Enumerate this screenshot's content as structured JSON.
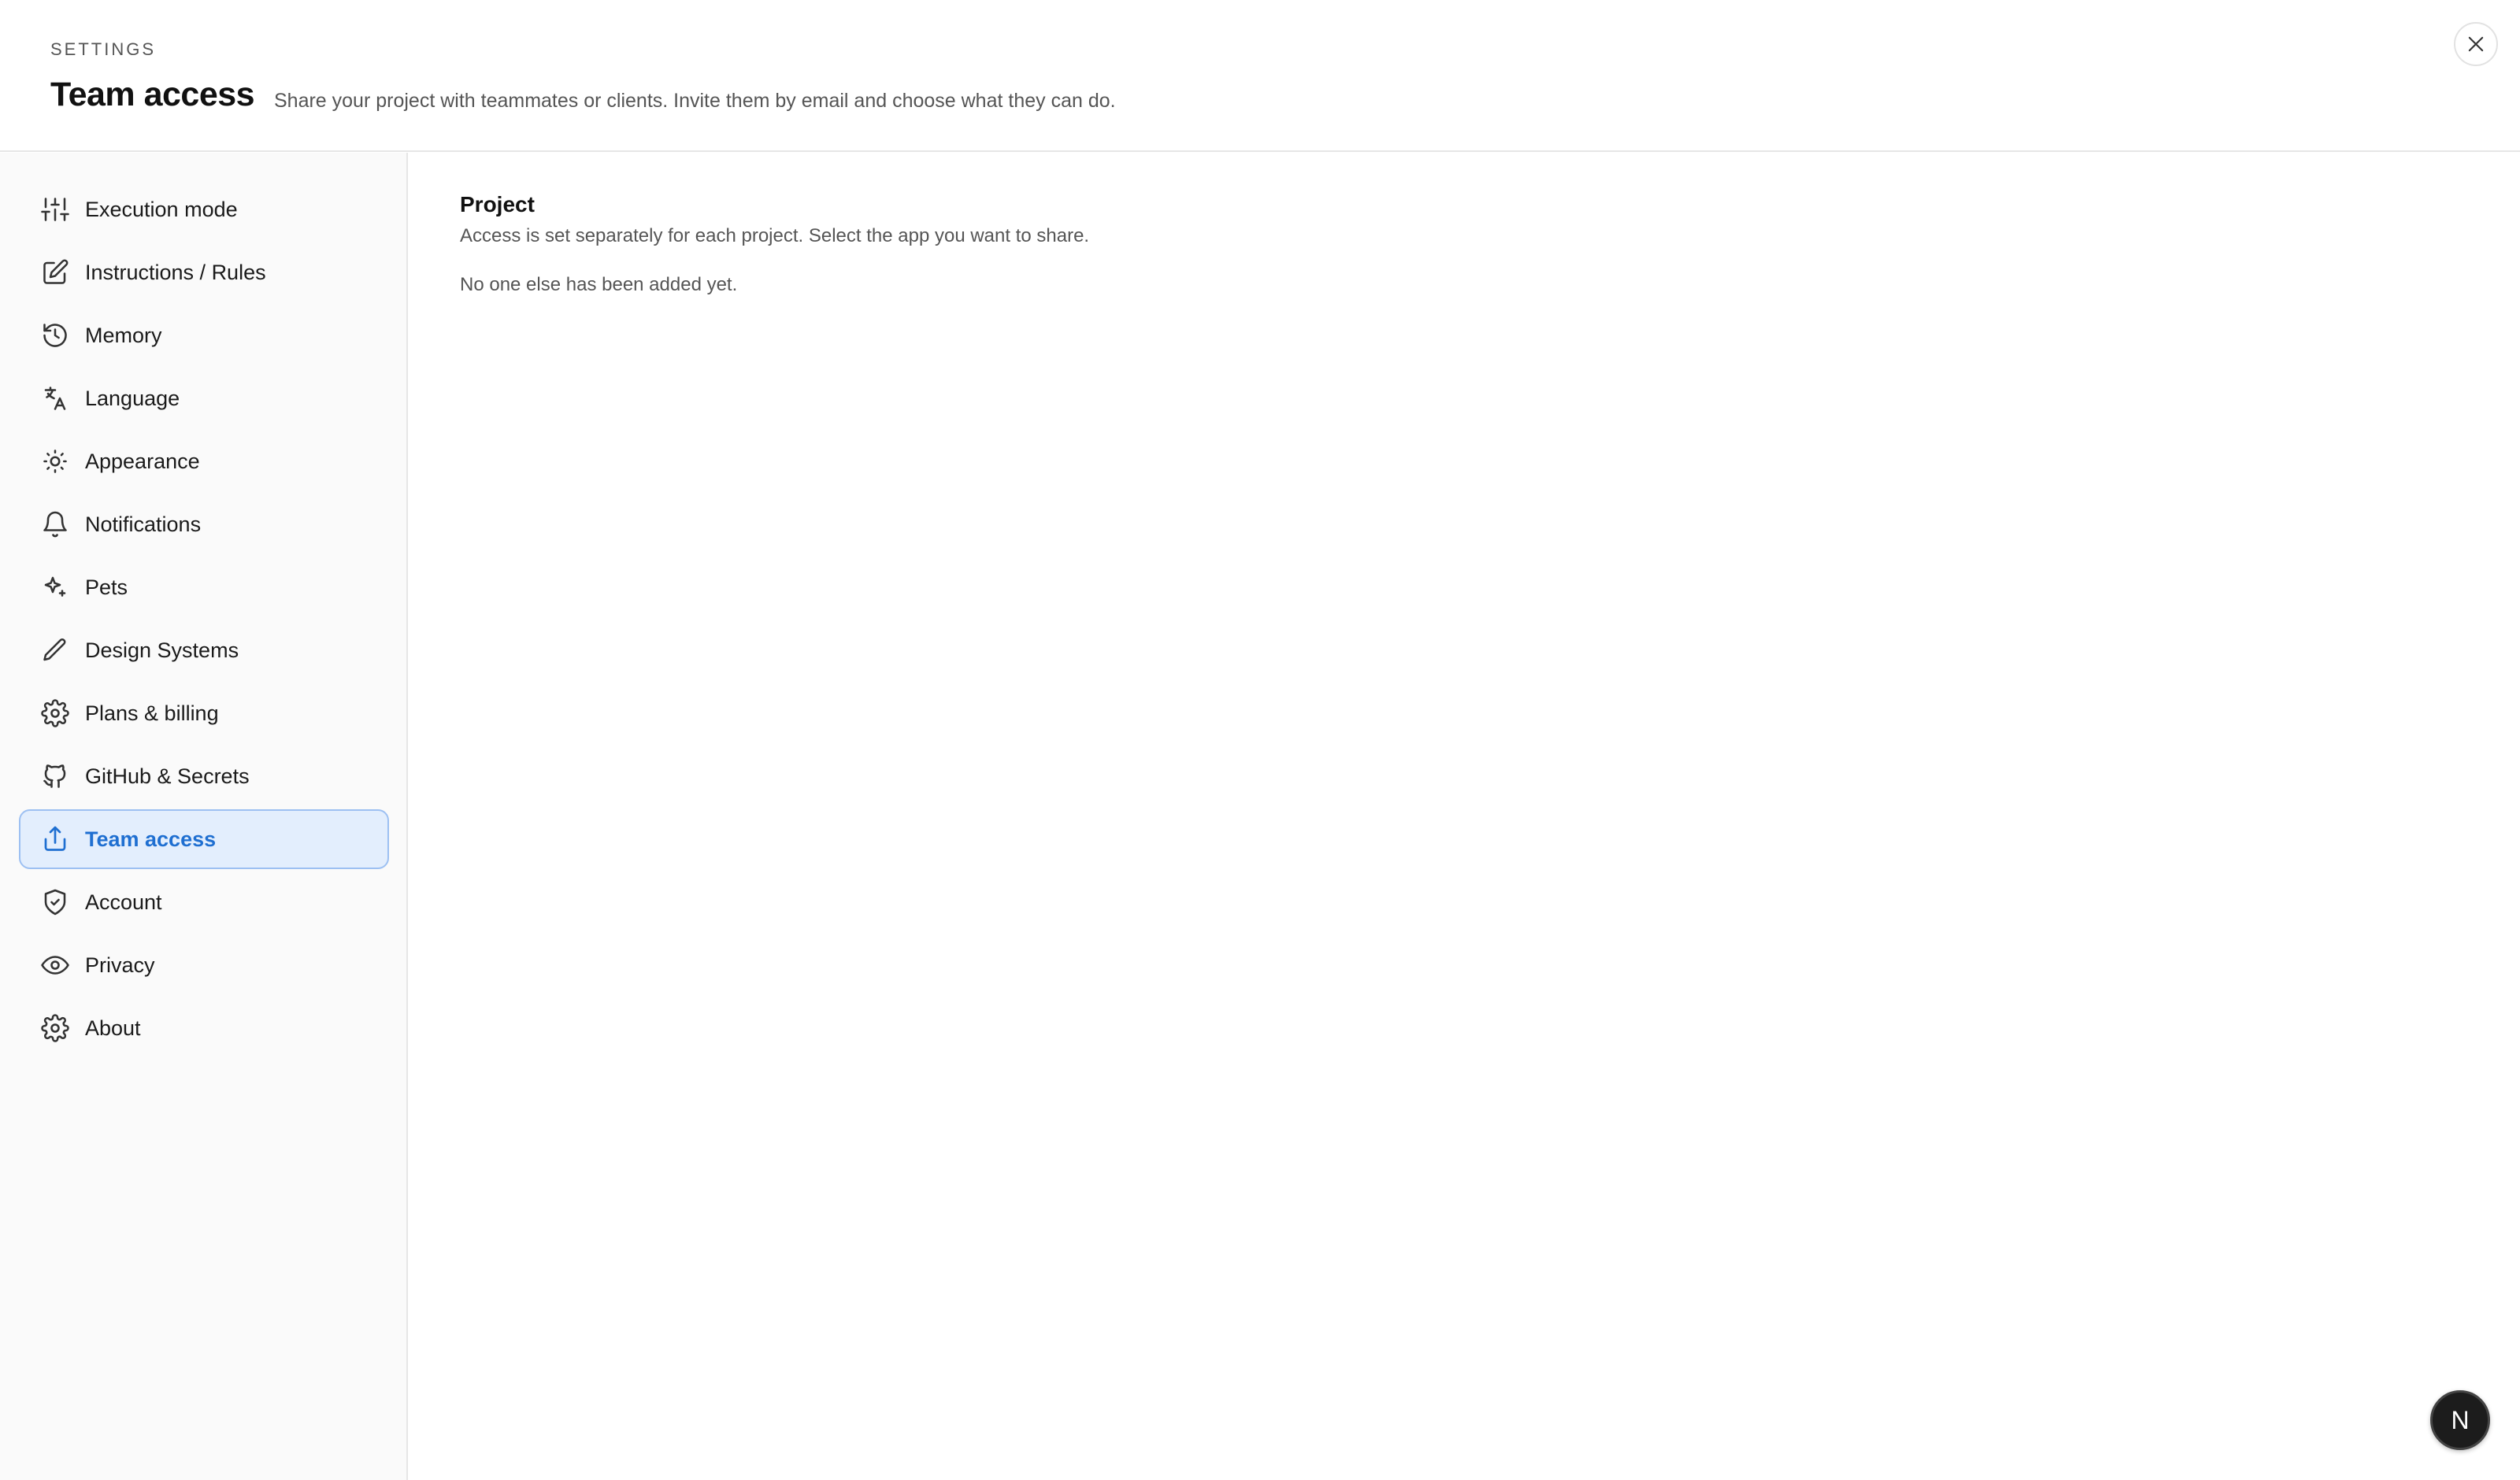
{
  "header": {
    "eyebrow": "SETTINGS",
    "title": "Team access",
    "subtitle": "Share your project with teammates or clients. Invite them by email and choose what they can do."
  },
  "sidebar": {
    "items": [
      {
        "label": "Execution mode",
        "icon": "sliders-icon"
      },
      {
        "label": "Instructions / Rules",
        "icon": "edit-icon"
      },
      {
        "label": "Memory",
        "icon": "history-icon"
      },
      {
        "label": "Language",
        "icon": "translate-icon"
      },
      {
        "label": "Appearance",
        "icon": "sun-icon"
      },
      {
        "label": "Notifications",
        "icon": "bell-icon"
      },
      {
        "label": "Pets",
        "icon": "sparkles-icon"
      },
      {
        "label": "Design Systems",
        "icon": "pencil-icon"
      },
      {
        "label": "Plans & billing",
        "icon": "gear-icon"
      },
      {
        "label": "GitHub & Secrets",
        "icon": "github-icon"
      },
      {
        "label": "Team access",
        "icon": "share-icon",
        "active": true
      },
      {
        "label": "Account",
        "icon": "shield-icon"
      },
      {
        "label": "Privacy",
        "icon": "eye-icon"
      },
      {
        "label": "About",
        "icon": "gear-icon"
      }
    ]
  },
  "main": {
    "section_title": "Project",
    "section_desc": "Access is set separately for each project. Select the app you want to share.",
    "empty_text": "No one else has been added yet."
  },
  "avatar": {
    "initial": "N"
  },
  "colors": {
    "accent": "#1f6fd1",
    "active_bg": "#e3eefd",
    "active_border": "#9dc0f2"
  }
}
